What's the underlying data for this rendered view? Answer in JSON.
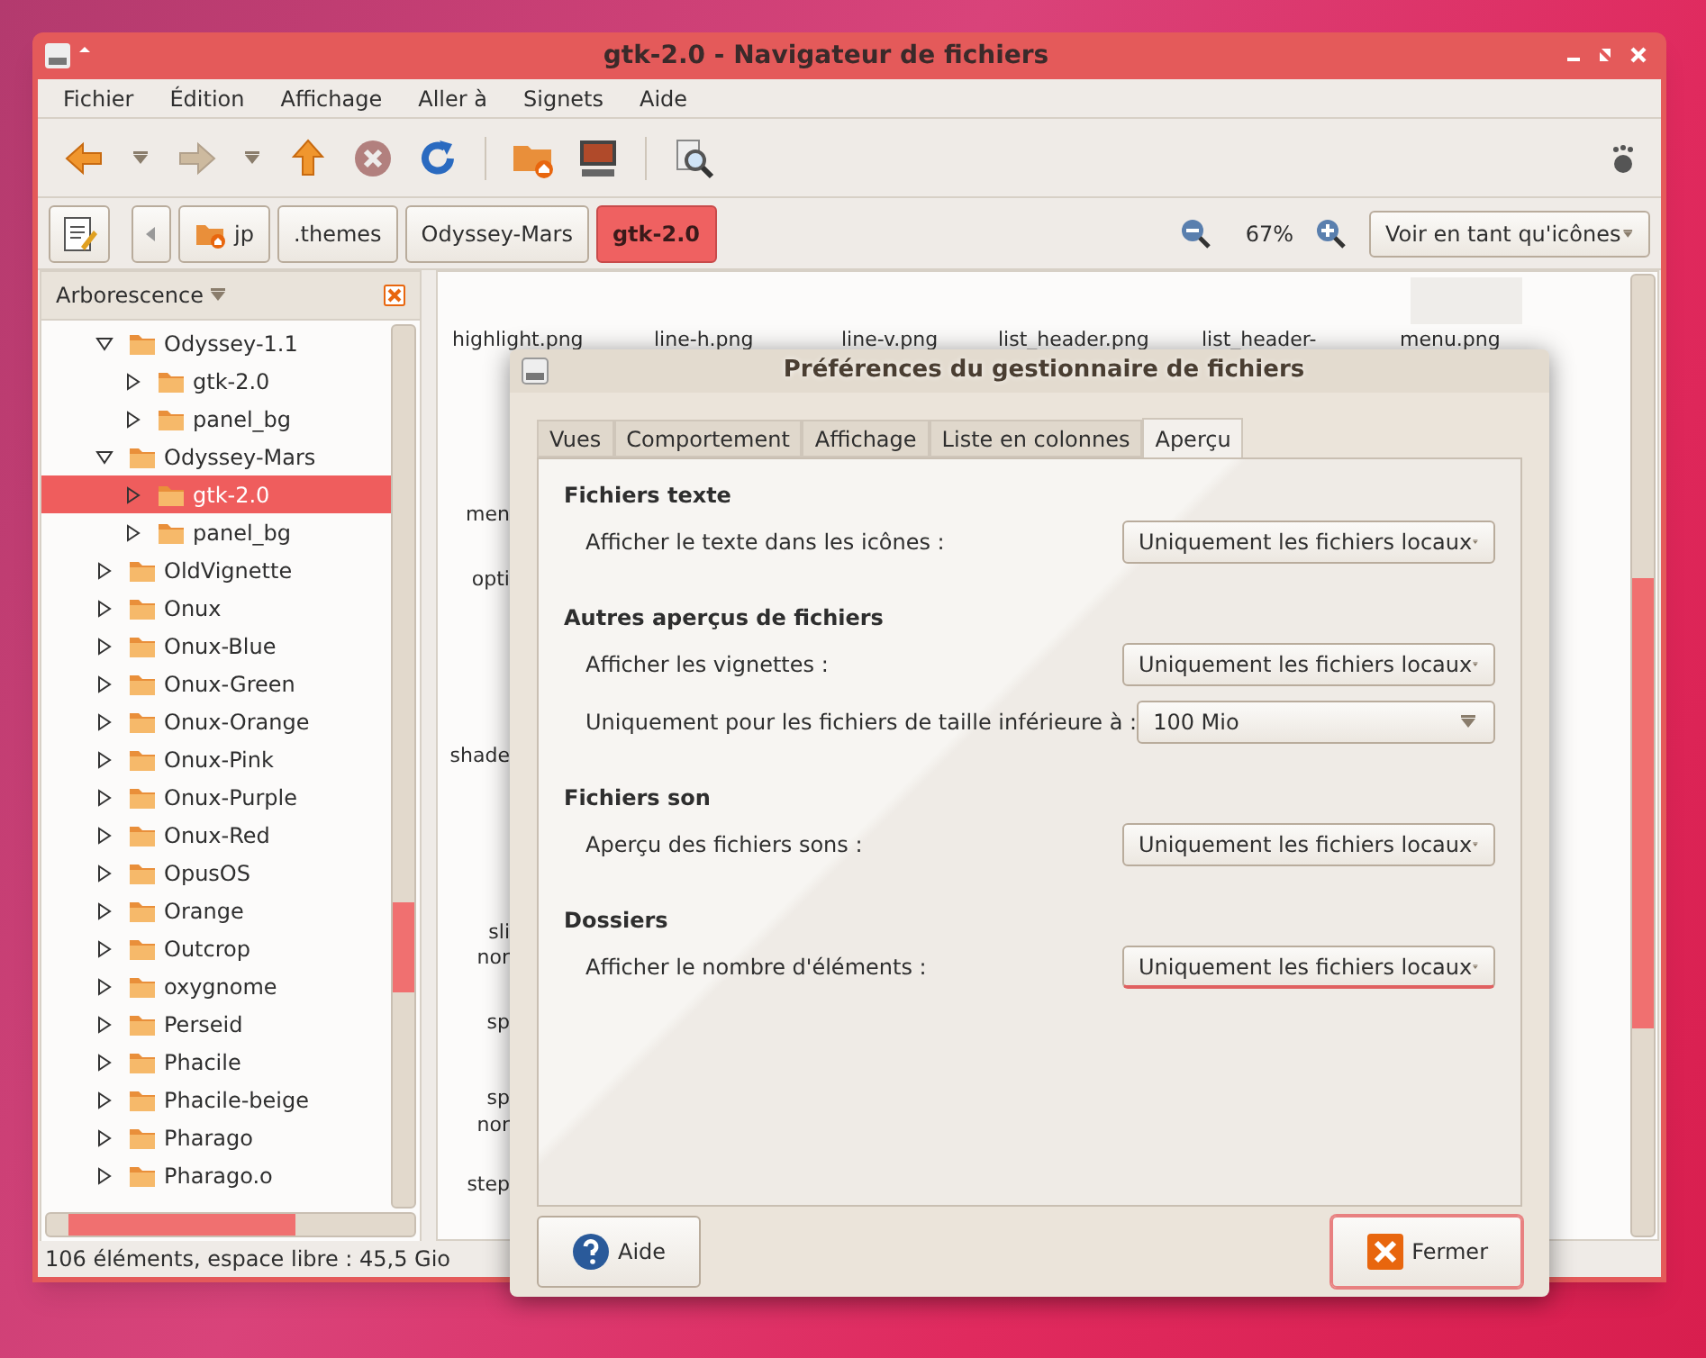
{
  "window": {
    "title": "gtk-2.0 - Navigateur de fichiers"
  },
  "menu": [
    "Fichier",
    "Édition",
    "Affichage",
    "Aller à",
    "Signets",
    "Aide"
  ],
  "toolbar": [
    {
      "kind": "back",
      "disabled": false
    },
    {
      "kind": "history",
      "disabled": false
    },
    {
      "kind": "forward",
      "disabled": true
    },
    {
      "kind": "history",
      "disabled": false
    },
    {
      "kind": "up",
      "disabled": false
    },
    {
      "kind": "stop",
      "disabled": true
    },
    {
      "kind": "reload",
      "disabled": false
    },
    {
      "kind": "separator",
      "disabled": false
    },
    {
      "kind": "home",
      "disabled": false
    },
    {
      "kind": "computer",
      "disabled": false
    },
    {
      "kind": "separator",
      "disabled": false
    },
    {
      "kind": "search",
      "disabled": false
    }
  ],
  "path": [
    {
      "label": "jp",
      "home": true,
      "selected": false
    },
    {
      "label": ".themes",
      "home": false,
      "selected": false
    },
    {
      "label": "Odyssey-Mars",
      "home": false,
      "selected": false
    },
    {
      "label": "gtk-2.0",
      "home": false,
      "selected": true
    }
  ],
  "zoom": "67%",
  "view_mode": "Voir en tant qu'icônes",
  "sidebar": {
    "title": "Arborescence",
    "items": [
      {
        "name": "Odyssey-1.1",
        "expanded": true,
        "selected": false,
        "children": [
          {
            "name": "gtk-2.0",
            "expanded": false,
            "selected": false
          },
          {
            "name": "panel_bg",
            "expanded": false,
            "selected": false
          }
        ]
      },
      {
        "name": "Odyssey-Mars",
        "expanded": true,
        "selected": false,
        "children": [
          {
            "name": "gtk-2.0",
            "expanded": false,
            "selected": true
          },
          {
            "name": "panel_bg",
            "expanded": false,
            "selected": false
          }
        ]
      },
      {
        "name": "OldVignette",
        "expanded": false,
        "selected": false
      },
      {
        "name": "Onux",
        "expanded": false,
        "selected": false
      },
      {
        "name": "Onux-Blue",
        "expanded": false,
        "selected": false
      },
      {
        "name": "Onux-Green",
        "expanded": false,
        "selected": false
      },
      {
        "name": "Onux-Orange",
        "expanded": false,
        "selected": false
      },
      {
        "name": "Onux-Pink",
        "expanded": false,
        "selected": false
      },
      {
        "name": "Onux-Purple",
        "expanded": false,
        "selected": false
      },
      {
        "name": "Onux-Red",
        "expanded": false,
        "selected": false
      },
      {
        "name": "OpusOS",
        "expanded": false,
        "selected": false
      },
      {
        "name": "Orange",
        "expanded": false,
        "selected": false
      },
      {
        "name": "Outcrop",
        "expanded": false,
        "selected": false
      },
      {
        "name": "oxygnome",
        "expanded": false,
        "selected": false
      },
      {
        "name": "Perseid",
        "expanded": false,
        "selected": false
      },
      {
        "name": "Phacile",
        "expanded": false,
        "selected": false
      },
      {
        "name": "Phacile-beige",
        "expanded": false,
        "selected": false
      },
      {
        "name": "Pharago",
        "expanded": false,
        "selected": false
      },
      {
        "name": "Pharago.o",
        "expanded": false,
        "selected": false
      }
    ]
  },
  "files_top": [
    "highlight.png",
    "line-h.png",
    "line-v.png",
    "list_header.png",
    "list_header-",
    "menu.png"
  ],
  "files_left": [
    "men",
    "opti",
    "shade",
    "sli",
    "nor",
    "sp",
    "sp",
    "nor",
    "step"
  ],
  "status_bar": "106 éléments, espace libre : 45,5 Gio",
  "dialog": {
    "title": "Préférences du gestionnaire de fichiers",
    "tabs": [
      {
        "label": "Vues",
        "selected": false
      },
      {
        "label": "Comportement",
        "selected": false
      },
      {
        "label": "Affichage",
        "selected": false
      },
      {
        "label": "Liste en colonnes",
        "selected": false
      },
      {
        "label": "Aperçu",
        "selected": true
      }
    ],
    "sections": [
      {
        "title": "Fichiers texte",
        "rows": [
          {
            "label": "Afficher le texte dans les icônes :",
            "value": "Uniquement les fichiers locaux",
            "focused": false
          }
        ]
      },
      {
        "title": "Autres aperçus de fichiers",
        "rows": [
          {
            "label": "Afficher les vignettes :",
            "value": "Uniquement les fichiers locaux",
            "focused": false
          },
          {
            "label": "Uniquement pour les fichiers de taille inférieure à :",
            "value": "100 Mio",
            "focused": false
          }
        ]
      },
      {
        "title": "Fichiers son",
        "rows": [
          {
            "label": "Aperçu des fichiers sons :",
            "value": "Uniquement les fichiers locaux",
            "focused": false
          }
        ]
      },
      {
        "title": "Dossiers",
        "rows": [
          {
            "label": "Afficher le nombre d'éléments :",
            "value": "Uniquement les fichiers locaux",
            "focused": true
          }
        ]
      }
    ],
    "buttons": [
      {
        "label": "Aide",
        "kind": "help",
        "focused": false
      },
      {
        "label": "Fermer",
        "kind": "close",
        "focused": true
      }
    ]
  }
}
